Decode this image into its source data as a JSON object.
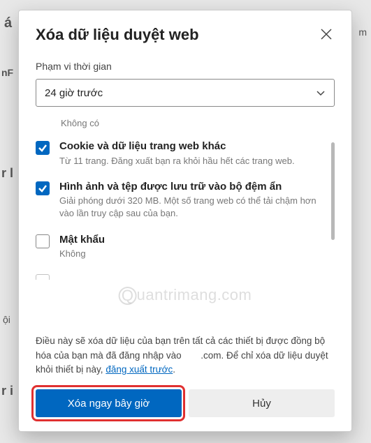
{
  "dialog": {
    "title": "Xóa dữ liệu duyệt web",
    "time_range_label": "Phạm vi thời gian",
    "time_range_value": "24 giờ trước",
    "history_none": "Không có",
    "items": [
      {
        "checked": true,
        "title": "Cookie và dữ liệu trang web khác",
        "desc": "Từ 11 trang. Đăng xuất bạn ra khỏi hầu hết các trang web."
      },
      {
        "checked": true,
        "title": "Hình ảnh và tệp được lưu trữ vào bộ đệm ẩn",
        "desc": "Giải phóng dưới 320 MB. Một số trang web có thể tải chậm hơn vào lần truy cập sau của bạn."
      },
      {
        "checked": false,
        "title": "Mật khẩu",
        "desc": "Không"
      }
    ],
    "footer_part1": "Điều này sẽ xóa dữ liệu của bạn trên tất cả các thiết bị được đồng bộ hóa của bạn mà đã đăng nhập vào ",
    "footer_domain": ".com",
    "footer_part2": ". Để chỉ xóa dữ liệu duyệt khỏi thiết bị này, ",
    "footer_link": "đăng xuất trước",
    "primary_btn": "Xóa ngay bây giờ",
    "secondary_btn": "Hủy"
  },
  "watermark": "uantrimang.com"
}
